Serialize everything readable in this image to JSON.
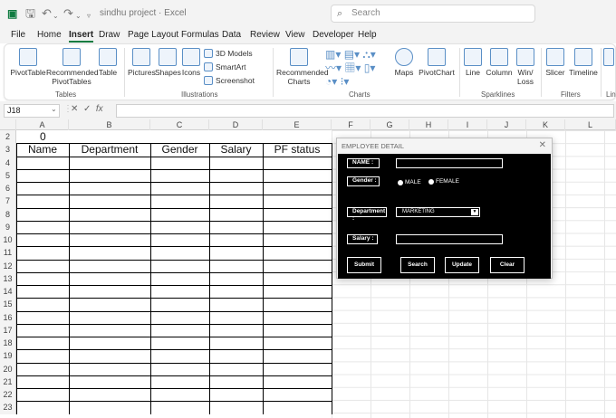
{
  "app": {
    "title": "sindhu project  ·  Excel",
    "search_placeholder": "Search"
  },
  "quick_access": {
    "autosave_icon": "save-icon",
    "undo": "↶",
    "redo": "↷"
  },
  "tabs": [
    "File",
    "Home",
    "Insert",
    "Draw",
    "Page Layout",
    "Formulas",
    "Data",
    "Review",
    "View",
    "Developer",
    "Help"
  ],
  "active_tab": "Insert",
  "ribbon": {
    "pivot_table": "PivotTable",
    "recommended_pivot": "Recommended PivotTables",
    "table": "Table",
    "pictures": "Pictures",
    "shapes": "Shapes",
    "icons": "Icons",
    "models": "3D Models",
    "smartart": "SmartArt",
    "screenshot": "Screenshot",
    "recommended_charts": "Recommended Charts",
    "maps": "Maps",
    "pivot_chart": "PivotChart",
    "line": "Line",
    "column": "Column",
    "winloss": "Win/ Loss",
    "slicer": "Slicer",
    "timeline": "Timeline",
    "groups": {
      "tables": "Tables",
      "illustrations": "Illustrations",
      "charts": "Charts",
      "sparklines": "Sparklines",
      "filters": "Filters",
      "links": "Link"
    }
  },
  "formula_bar": {
    "name_box": "J18",
    "fx": "fx",
    "value": ""
  },
  "columns": [
    "A",
    "B",
    "C",
    "D",
    "E",
    "F",
    "G",
    "H",
    "I",
    "J",
    "K",
    "L"
  ],
  "rows": [
    "2",
    "3",
    "4",
    "5",
    "6",
    "7",
    "8",
    "9",
    "10",
    "11",
    "12",
    "13",
    "14",
    "15",
    "16",
    "17",
    "18",
    "19",
    "20",
    "21",
    "22",
    "23"
  ],
  "sheet": {
    "a2_value": "0",
    "headers": [
      "Name",
      "Department",
      "Gender",
      "Salary",
      "PF status"
    ]
  },
  "dialog": {
    "title": "EMPLOYEE DETAIL",
    "name_label": "NAME :",
    "gender_label": "Gender :",
    "male": "MALE",
    "female": "FEMALE",
    "department_label": "Department :",
    "department_value": "MARKETING",
    "salary_label": "Salary :",
    "submit": "Submit",
    "search": "Search",
    "update": "Update",
    "clear": "Clear"
  }
}
